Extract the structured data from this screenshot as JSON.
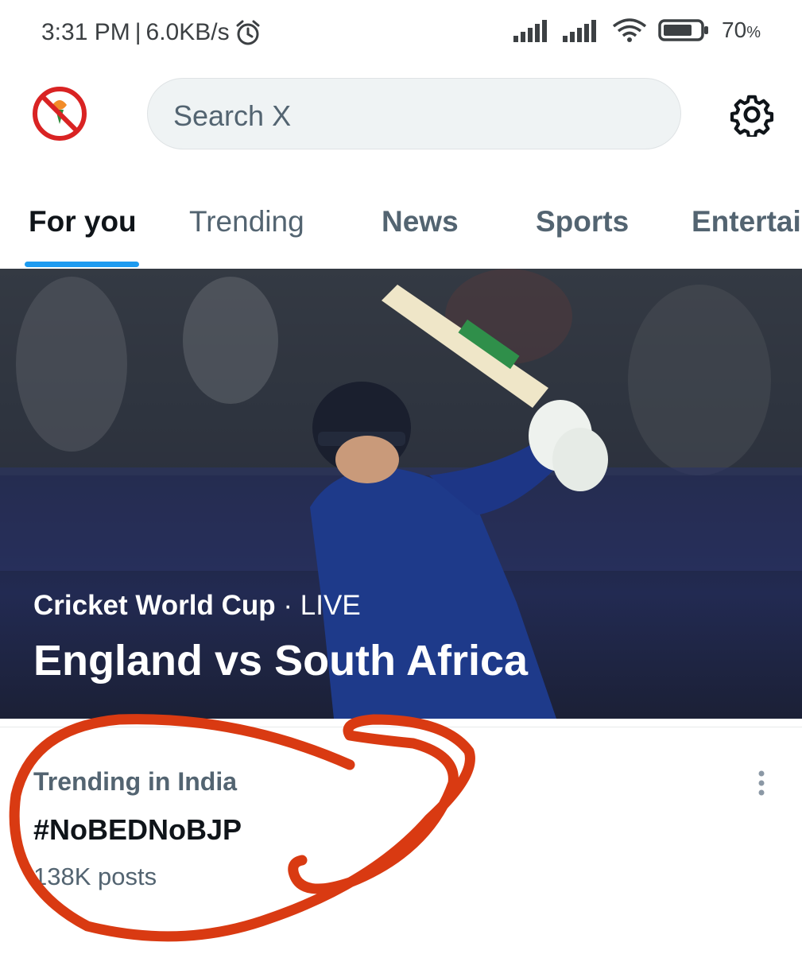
{
  "status_bar": {
    "time": "3:31 PM",
    "separator": "|",
    "speed": "6.0KB/s",
    "battery": "70",
    "battery_unit": "%",
    "icons": [
      "alarm-icon",
      "signal-icon",
      "signal-icon",
      "wifi-icon",
      "battery-icon"
    ]
  },
  "header": {
    "avatar_text": "NoBEDNoBJP",
    "search_placeholder": "Search X",
    "settings_icon": "gear-icon"
  },
  "tabs": [
    {
      "label": "For you",
      "active": true
    },
    {
      "label": "Trending",
      "active": false
    },
    {
      "label": "News",
      "active": false
    },
    {
      "label": "Sports",
      "active": false
    },
    {
      "label": "Entertai",
      "active": false
    }
  ],
  "hero": {
    "category": "Cricket World Cup",
    "dot": " · ",
    "status": "LIVE",
    "title": "England vs South Africa"
  },
  "trend": {
    "context": "Trending in India",
    "tag": "#NoBEDNoBJP",
    "count": "138K posts",
    "more_icon": "more-vertical-icon"
  },
  "colors": {
    "accent": "#1d9bf0",
    "annotation": "#d93a12",
    "text_secondary": "#536471"
  }
}
